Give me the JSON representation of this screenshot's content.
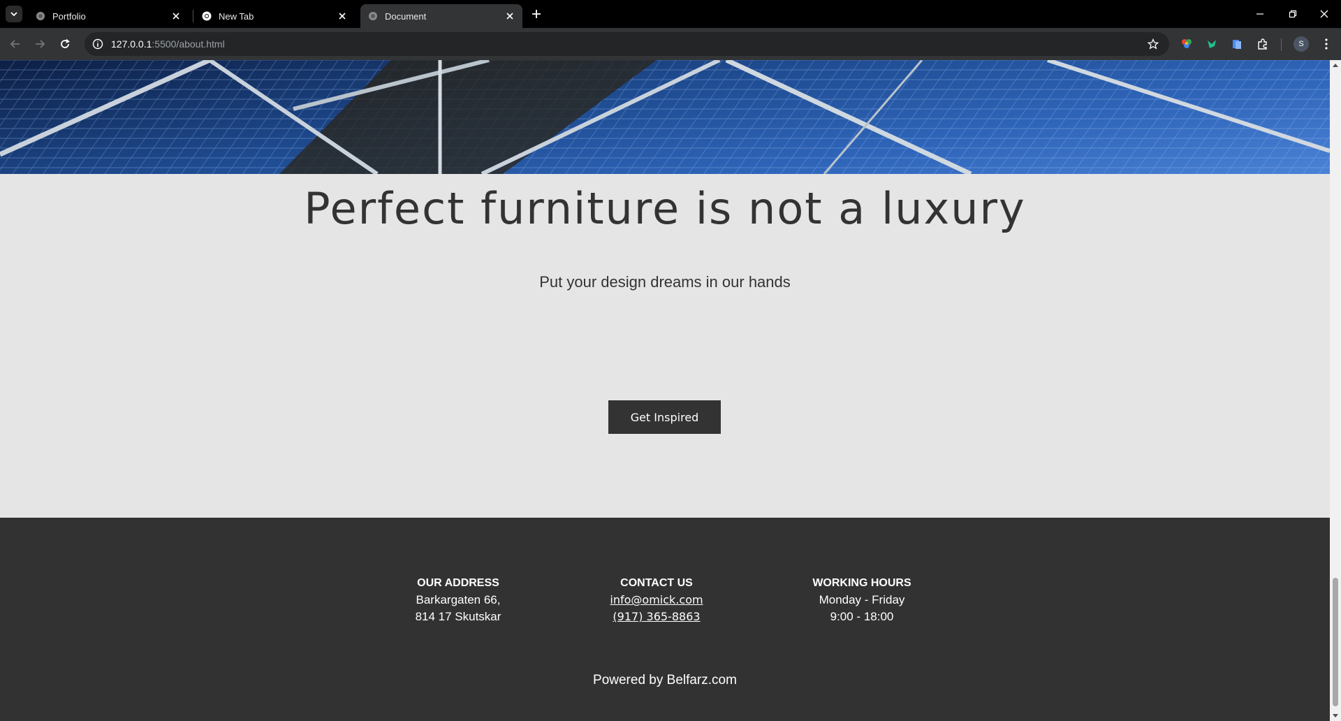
{
  "browser": {
    "tabs": [
      {
        "title": "Portfolio",
        "active": false
      },
      {
        "title": "New Tab",
        "active": false
      },
      {
        "title": "Document",
        "active": true
      }
    ],
    "url_host": "127.0.0.1",
    "url_path": ":5500/about.html",
    "profile_initial": "S"
  },
  "cta": {
    "title": "Perfect furniture is not a luxury",
    "subtitle": "Put your design dreams in our hands",
    "button": "Get Inspired"
  },
  "footer": {
    "address": {
      "heading": "OUR ADDRESS",
      "line1": "Barkargaten 66,",
      "line2": "814 17 Skutskar"
    },
    "contact": {
      "heading": "CONTACT US",
      "email": "info@omick.com",
      "phone": "(917) 365-8863"
    },
    "hours": {
      "heading": "WORKING HOURS",
      "days": "Monday - Friday",
      "time": "9:00 - 18:00"
    },
    "powered": "Powered by Belfarz.com"
  }
}
